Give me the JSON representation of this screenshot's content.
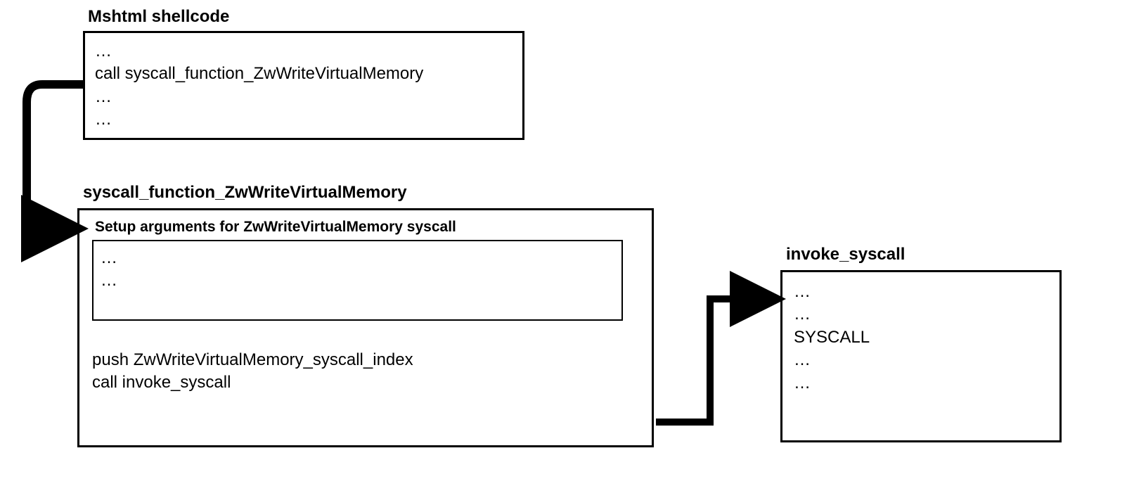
{
  "box1": {
    "title": "Mshtml shellcode",
    "line1": "…",
    "line2": "call syscall_function_ZwWriteVirtualMemory",
    "line3": "…",
    "line4": "…"
  },
  "box2": {
    "title": "syscall_function_ZwWriteVirtualMemory",
    "innerTitle": "Setup arguments for ZwWriteVirtualMemory syscall",
    "innerLine1": "…",
    "innerLine2": "…",
    "line1": "push ZwWriteVirtualMemory_syscall_index",
    "line2": "call invoke_syscall"
  },
  "box3": {
    "title": "invoke_syscall",
    "line1": "…",
    "line2": "…",
    "line3": "SYSCALL",
    "line4": "…",
    "line5": "…"
  }
}
